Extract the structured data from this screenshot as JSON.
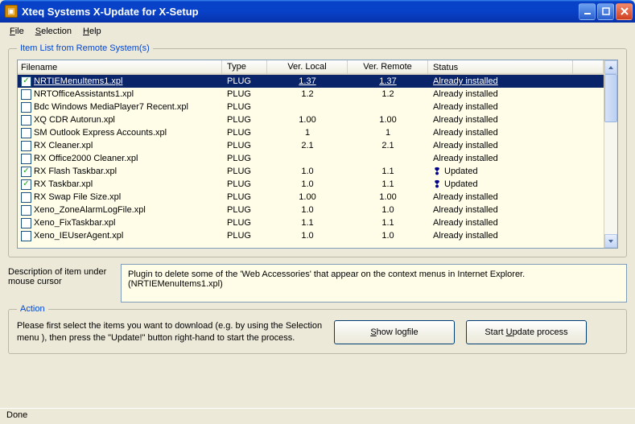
{
  "window": {
    "title": "Xteq Systems X-Update for X-Setup"
  },
  "menu": {
    "file": "File",
    "selection": "Selection",
    "help": "Help"
  },
  "group_list_title": "Item List from Remote System(s)",
  "columns": {
    "filename": "Filename",
    "type": "Type",
    "ver_local": "Ver. Local",
    "ver_remote": "Ver. Remote",
    "status": "Status"
  },
  "rows": [
    {
      "checked": true,
      "selected": true,
      "filename": "NRTIEMenuItems1.xpl",
      "type": "PLUG",
      "vl": "1.37",
      "vr": "1.37",
      "status": "Already installed",
      "status_icon": ""
    },
    {
      "checked": false,
      "selected": false,
      "filename": "NRTOfficeAssistants1.xpl",
      "type": "PLUG",
      "vl": "1.2",
      "vr": "1.2",
      "status": "Already installed",
      "status_icon": ""
    },
    {
      "checked": false,
      "selected": false,
      "filename": "Bdc Windows MediaPlayer7 Recent.xpl",
      "type": "PLUG",
      "vl": "",
      "vr": "",
      "status": "Already installed",
      "status_icon": ""
    },
    {
      "checked": false,
      "selected": false,
      "filename": "XQ CDR Autorun.xpl",
      "type": "PLUG",
      "vl": "1.00",
      "vr": "1.00",
      "status": "Already installed",
      "status_icon": ""
    },
    {
      "checked": false,
      "selected": false,
      "filename": "SM Outlook Express Accounts.xpl",
      "type": "PLUG",
      "vl": "1",
      "vr": "1",
      "status": "Already installed",
      "status_icon": ""
    },
    {
      "checked": false,
      "selected": false,
      "filename": "RX Cleaner.xpl",
      "type": "PLUG",
      "vl": "2.1",
      "vr": "2.1",
      "status": "Already installed",
      "status_icon": ""
    },
    {
      "checked": false,
      "selected": false,
      "filename": "RX Office2000 Cleaner.xpl",
      "type": "PLUG",
      "vl": "",
      "vr": "",
      "status": "Already installed",
      "status_icon": ""
    },
    {
      "checked": true,
      "selected": false,
      "filename": "RX Flash Taskbar.xpl",
      "type": "PLUG",
      "vl": "1.0",
      "vr": "1.1",
      "status": "Updated",
      "status_icon": "!"
    },
    {
      "checked": true,
      "selected": false,
      "filename": "RX Taskbar.xpl",
      "type": "PLUG",
      "vl": "1.0",
      "vr": "1.1",
      "status": "Updated",
      "status_icon": "!"
    },
    {
      "checked": false,
      "selected": false,
      "filename": "RX Swap File Size.xpl",
      "type": "PLUG",
      "vl": "1.00",
      "vr": "1.00",
      "status": "Already installed",
      "status_icon": ""
    },
    {
      "checked": false,
      "selected": false,
      "filename": "Xeno_ZoneAlarmLogFile.xpl",
      "type": "PLUG",
      "vl": "1.0",
      "vr": "1.0",
      "status": "Already installed",
      "status_icon": ""
    },
    {
      "checked": false,
      "selected": false,
      "filename": "Xeno_FixTaskbar.xpl",
      "type": "PLUG",
      "vl": "1.1",
      "vr": "1.1",
      "status": "Already installed",
      "status_icon": ""
    },
    {
      "checked": false,
      "selected": false,
      "filename": "Xeno_IEUserAgent.xpl",
      "type": "PLUG",
      "vl": "1.0",
      "vr": "1.0",
      "status": "Already installed",
      "status_icon": ""
    }
  ],
  "description": {
    "label": "Description of item under mouse cursor",
    "text": "Plugin to delete some of the 'Web Accessories' that appear on the context menus in Internet Explorer. (NRTIEMenuItems1.xpl)"
  },
  "action": {
    "group_title": "Action",
    "instructions": "Please first select the items you want to download (e.g. by using the Selection menu ), then press the \"Update!\" button right-hand to start the process.",
    "show_logfile": "Show logfile",
    "start_update": "Start Update process"
  },
  "statusbar": "Done"
}
